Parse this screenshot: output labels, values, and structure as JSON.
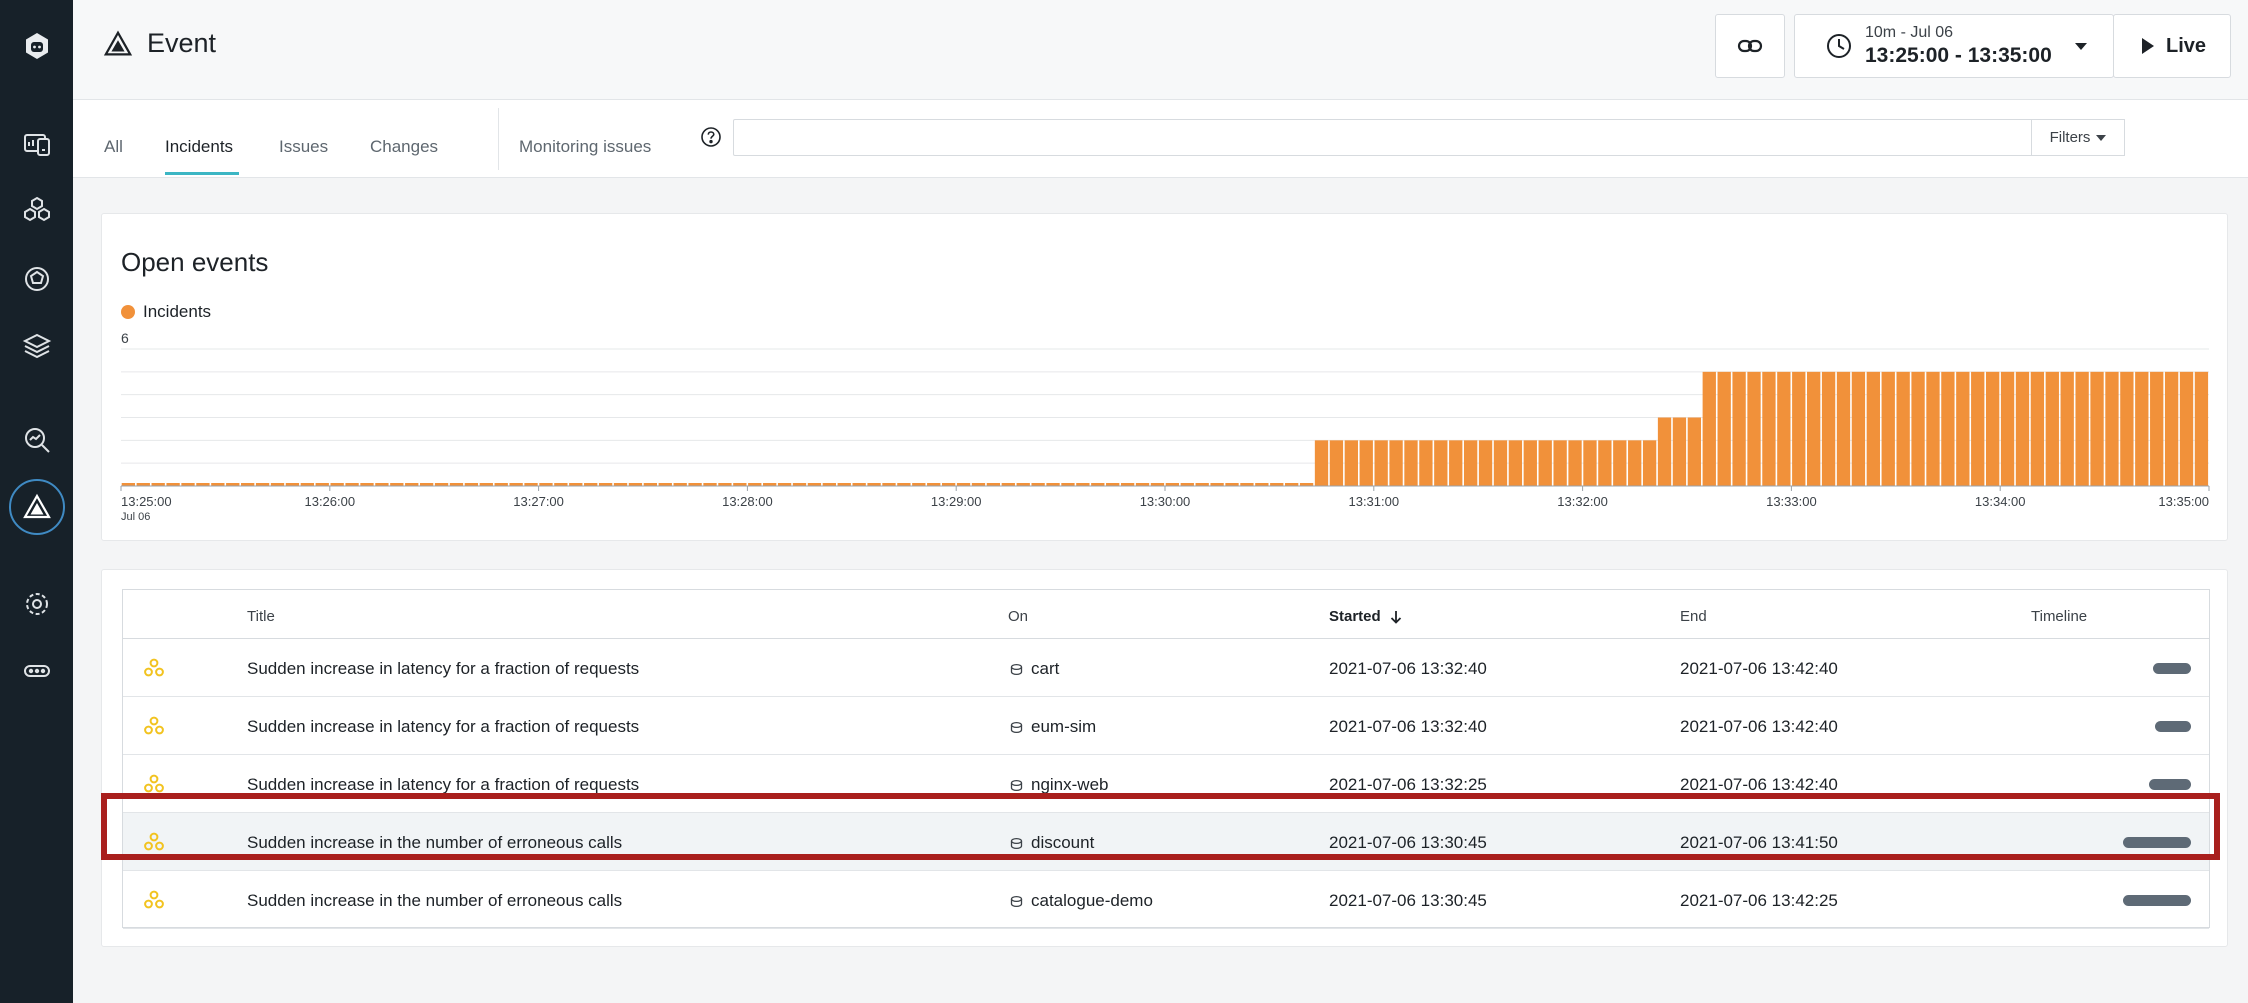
{
  "sidebar": {
    "items": [
      {
        "name": "logo-icon"
      },
      {
        "name": "dashboard-icon"
      },
      {
        "name": "applications-icon"
      },
      {
        "name": "platforms-icon"
      },
      {
        "name": "infrastructure-icon"
      },
      {
        "name": "analytics-icon"
      },
      {
        "name": "events-icon",
        "active": true
      },
      {
        "name": "settings-icon"
      },
      {
        "name": "more-icon"
      }
    ]
  },
  "header": {
    "title": "Event",
    "time_range_small": "10m - Jul 06",
    "time_range": "13:25:00 - 13:35:00",
    "live_label": "Live"
  },
  "tabs": {
    "items": [
      {
        "label": "All",
        "active": false
      },
      {
        "label": "Incidents",
        "active": true
      },
      {
        "label": "Issues",
        "active": false
      },
      {
        "label": "Changes",
        "active": false
      }
    ],
    "monitoring_label": "Monitoring issues",
    "search_value": "",
    "filters_label": "Filters"
  },
  "chart_panel": {
    "title": "Open events",
    "legend_label": "Incidents"
  },
  "chart_data": {
    "type": "bar",
    "title": "Open events",
    "series": [
      {
        "name": "Incidents",
        "color": "#f1913a",
        "values": [
          0,
          0,
          0,
          0,
          0,
          0,
          0,
          0,
          0,
          0,
          0,
          0,
          0,
          0,
          0,
          0,
          0,
          0,
          0,
          0,
          0,
          0,
          0,
          0,
          0,
          0,
          0,
          0,
          0,
          0,
          0,
          0,
          0,
          0,
          0,
          0,
          0,
          0,
          0,
          0,
          0,
          0,
          0,
          0,
          0,
          0,
          0,
          0,
          0,
          0,
          0,
          0,
          0,
          0,
          0,
          0,
          0,
          0,
          0,
          0,
          0,
          0,
          0,
          0,
          0,
          0,
          0,
          0,
          0,
          0,
          0,
          0,
          0,
          0,
          0,
          0,
          0,
          0,
          0,
          0,
          2,
          2,
          2,
          2,
          2,
          2,
          2,
          2,
          2,
          2,
          2,
          2,
          2,
          2,
          2,
          2,
          2,
          2,
          2,
          2,
          2,
          2,
          2,
          3,
          3,
          3,
          5,
          5,
          5,
          5,
          5,
          5,
          5,
          5,
          5,
          5,
          5,
          5,
          5,
          5,
          5,
          5,
          5,
          5,
          5,
          5,
          5,
          5,
          5,
          5,
          5,
          5,
          5,
          5,
          5,
          5,
          5,
          5,
          5,
          5
        ]
      }
    ],
    "ylim": [
      0,
      6
    ],
    "ytick_label": "6",
    "xticks": [
      "13:25:00",
      "13:26:00",
      "13:27:00",
      "13:28:00",
      "13:29:00",
      "13:30:00",
      "13:31:00",
      "13:32:00",
      "13:33:00",
      "13:34:00",
      "13:35:00"
    ],
    "xtick_sublabel": "Jul 06",
    "grid": true
  },
  "table": {
    "columns": {
      "title": "Title",
      "on": "On",
      "started": "Started",
      "end": "End",
      "timeline": "Timeline"
    },
    "rows": [
      {
        "title": "Sudden increase in latency for a fraction of requests",
        "on": "cart",
        "started": "2021-07-06 13:32:40",
        "end": "2021-07-06 13:42:40",
        "highlighted": false
      },
      {
        "title": "Sudden increase in latency for a fraction of requests",
        "on": "eum-sim",
        "started": "2021-07-06 13:32:40",
        "end": "2021-07-06 13:42:40",
        "highlighted": false
      },
      {
        "title": "Sudden increase in latency for a fraction of requests",
        "on": "nginx-web",
        "started": "2021-07-06 13:32:25",
        "end": "2021-07-06 13:42:40",
        "highlighted": false
      },
      {
        "title": "Sudden increase in the number of erroneous calls",
        "on": "discount",
        "started": "2021-07-06 13:30:45",
        "end": "2021-07-06 13:41:50",
        "highlighted": true
      },
      {
        "title": "Sudden increase in the number of erroneous calls",
        "on": "catalogue-demo",
        "started": "2021-07-06 13:30:45",
        "end": "2021-07-06 13:42:25",
        "highlighted": false
      }
    ]
  },
  "colors": {
    "accent": "#3cb6c4",
    "bar": "#f1913a",
    "sidebar": "#172129",
    "highlight": "#a91f1d",
    "incident_icon": "#f2c31f"
  }
}
